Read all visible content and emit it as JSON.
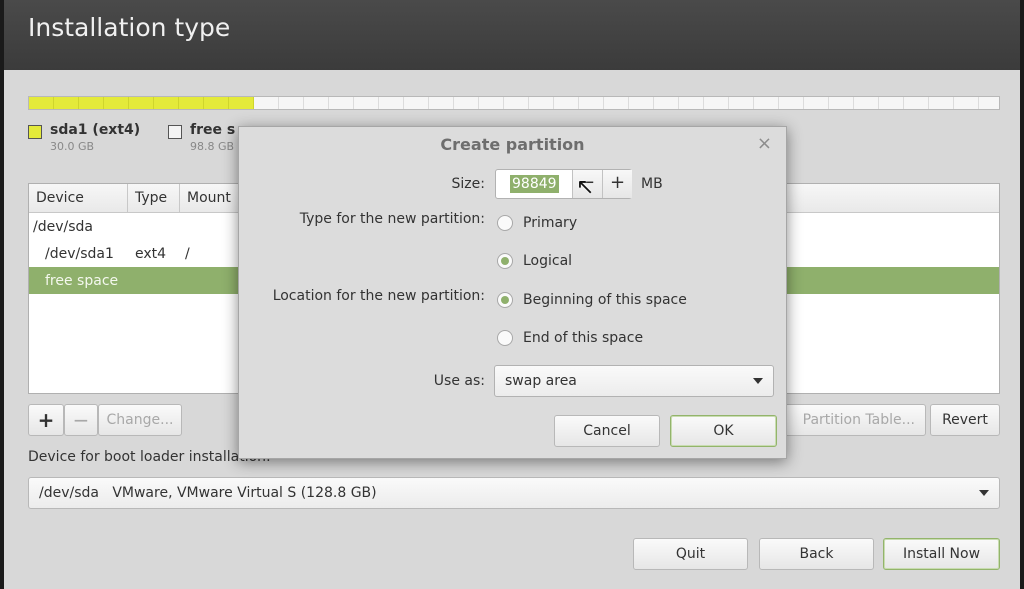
{
  "window": {
    "title": "Installation type"
  },
  "disk": {
    "used_fraction": 0.232,
    "legend": [
      {
        "name": "sda1 (ext4)",
        "size": "30.0 GB",
        "color": "#e4ea3a"
      },
      {
        "name": "free s",
        "size": "98.8 GB",
        "color": "#f4f4f4"
      }
    ]
  },
  "partition_table": {
    "columns": [
      "Device",
      "Type",
      "Mount"
    ],
    "rows": [
      {
        "device": "/dev/sda",
        "type": "",
        "mount": ""
      },
      {
        "device": "/dev/sda1",
        "type": "ext4",
        "mount": "/"
      },
      {
        "device": "free space",
        "type": "",
        "mount": ""
      }
    ],
    "selected_row": 2
  },
  "table_buttons": {
    "add": "+",
    "remove": "−",
    "change": "Change...",
    "new_table": "Partition Table...",
    "revert": "Revert"
  },
  "boot_loader": {
    "label": "Device for boot loader installation:",
    "value": "/dev/sda   VMware, VMware Virtual S (128.8 GB)"
  },
  "footer": {
    "quit": "Quit",
    "back": "Back",
    "install": "Install Now"
  },
  "dialog": {
    "title": "Create partition",
    "close": "×",
    "size_label": "Size:",
    "size_value": "98849",
    "size_unit": "MB",
    "minus": "−",
    "plus": "+",
    "type_label": "Type for the new partition:",
    "type_options": [
      {
        "label": "Primary",
        "selected": false
      },
      {
        "label": "Logical",
        "selected": true
      }
    ],
    "location_label": "Location for the new partition:",
    "location_options": [
      {
        "label": "Beginning of this space",
        "selected": true
      },
      {
        "label": "End of this space",
        "selected": false
      }
    ],
    "useas_label": "Use as:",
    "useas_value": "swap area",
    "cancel": "Cancel",
    "ok": "OK"
  },
  "colors": {
    "accent": "#8fb06c",
    "partition_used": "#e4ea3a",
    "titlebar": "#3f3f3f"
  }
}
